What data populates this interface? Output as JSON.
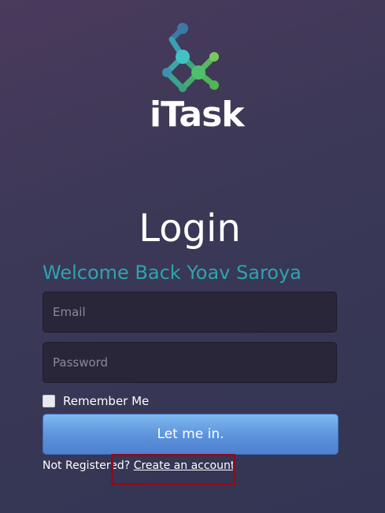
{
  "brand": {
    "logo_text": "iTask"
  },
  "login": {
    "title": "Login",
    "welcome": "Welcome Back Yoav Saroya",
    "email_placeholder": "Email",
    "password_placeholder": "Password",
    "remember_label": "Remember Me",
    "remember_checked": false,
    "submit_label": "Let me in.",
    "not_registered": "Not Registered?",
    "create_account_link": "Create an account"
  },
  "colors": {
    "accent": "#2fa3b0",
    "button": "#5b92db",
    "highlight": "#8a0f1e"
  }
}
